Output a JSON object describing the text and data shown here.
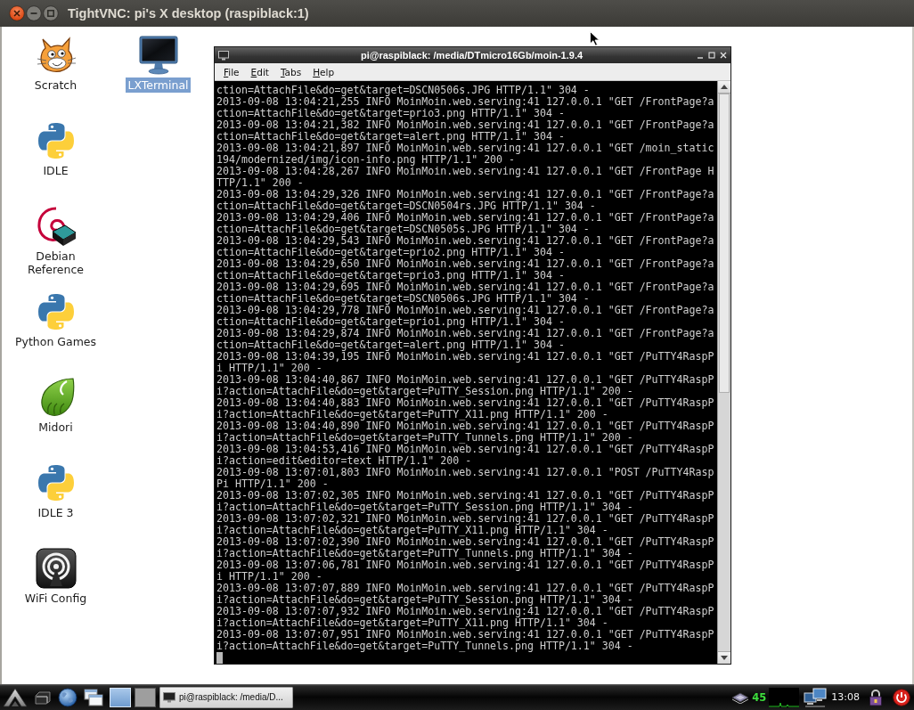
{
  "window": {
    "title": "TightVNC: pi's X desktop (raspiblack:1)"
  },
  "desktop_icons": [
    {
      "label": "Scratch",
      "kind": "scratch",
      "selected": false
    },
    {
      "label": "IDLE",
      "kind": "python",
      "selected": false
    },
    {
      "label": "Debian Reference",
      "kind": "debian",
      "selected": false
    },
    {
      "label": "Python Games",
      "kind": "python",
      "selected": false
    },
    {
      "label": "Midori",
      "kind": "midori",
      "selected": false
    },
    {
      "label": "IDLE 3",
      "kind": "python",
      "selected": false
    },
    {
      "label": "WiFi Config",
      "kind": "wifi",
      "selected": false
    },
    {
      "label": "LXTerminal",
      "kind": "terminal",
      "selected": true
    }
  ],
  "terminal": {
    "title": "pi@raspiblack: /media/DTmicro16Gb/moin-1.9.4",
    "menu": [
      "File",
      "Edit",
      "Tabs",
      "Help"
    ],
    "lines": [
      "ction=AttachFile&do=get&target=DSCN0506s.JPG HTTP/1.1\" 304 -",
      "2013-09-08 13:04:21,255 INFO MoinMoin.web.serving:41 127.0.0.1 \"GET /FrontPage?a",
      "ction=AttachFile&do=get&target=prio3.png HTTP/1.1\" 304 -",
      "2013-09-08 13:04:21,382 INFO MoinMoin.web.serving:41 127.0.0.1 \"GET /FrontPage?a",
      "ction=AttachFile&do=get&target=alert.png HTTP/1.1\" 304 -",
      "2013-09-08 13:04:21,897 INFO MoinMoin.web.serving:41 127.0.0.1 \"GET /moin_static",
      "194/modernized/img/icon-info.png HTTP/1.1\" 200 -",
      "2013-09-08 13:04:28,267 INFO MoinMoin.web.serving:41 127.0.0.1 \"GET /FrontPage H",
      "TTP/1.1\" 200 -",
      "2013-09-08 13:04:29,326 INFO MoinMoin.web.serving:41 127.0.0.1 \"GET /FrontPage?a",
      "ction=AttachFile&do=get&target=DSCN0504rs.JPG HTTP/1.1\" 304 -",
      "2013-09-08 13:04:29,406 INFO MoinMoin.web.serving:41 127.0.0.1 \"GET /FrontPage?a",
      "ction=AttachFile&do=get&target=DSCN0505s.JPG HTTP/1.1\" 304 -",
      "2013-09-08 13:04:29,543 INFO MoinMoin.web.serving:41 127.0.0.1 \"GET /FrontPage?a",
      "ction=AttachFile&do=get&target=prio2.png HTTP/1.1\" 304 -",
      "2013-09-08 13:04:29,650 INFO MoinMoin.web.serving:41 127.0.0.1 \"GET /FrontPage?a",
      "ction=AttachFile&do=get&target=prio3.png HTTP/1.1\" 304 -",
      "2013-09-08 13:04:29,695 INFO MoinMoin.web.serving:41 127.0.0.1 \"GET /FrontPage?a",
      "ction=AttachFile&do=get&target=DSCN0506s.JPG HTTP/1.1\" 304 -",
      "2013-09-08 13:04:29,778 INFO MoinMoin.web.serving:41 127.0.0.1 \"GET /FrontPage?a",
      "ction=AttachFile&do=get&target=prio1.png HTTP/1.1\" 304 -",
      "2013-09-08 13:04:29,874 INFO MoinMoin.web.serving:41 127.0.0.1 \"GET /FrontPage?a",
      "ction=AttachFile&do=get&target=alert.png HTTP/1.1\" 304 -",
      "2013-09-08 13:04:39,195 INFO MoinMoin.web.serving:41 127.0.0.1 \"GET /PuTTY4RaspP",
      "i HTTP/1.1\" 200 -",
      "2013-09-08 13:04:40,867 INFO MoinMoin.web.serving:41 127.0.0.1 \"GET /PuTTY4RaspP",
      "i?action=AttachFile&do=get&target=PuTTY_Session.png HTTP/1.1\" 200 -",
      "2013-09-08 13:04:40,883 INFO MoinMoin.web.serving:41 127.0.0.1 \"GET /PuTTY4RaspP",
      "i?action=AttachFile&do=get&target=PuTTY_X11.png HTTP/1.1\" 200 -",
      "2013-09-08 13:04:40,890 INFO MoinMoin.web.serving:41 127.0.0.1 \"GET /PuTTY4RaspP",
      "i?action=AttachFile&do=get&target=PuTTY_Tunnels.png HTTP/1.1\" 200 -",
      "2013-09-08 13:04:53,416 INFO MoinMoin.web.serving:41 127.0.0.1 \"GET /PuTTY4RaspP",
      "i?action=edit&editor=text HTTP/1.1\" 200 -",
      "2013-09-08 13:07:01,803 INFO MoinMoin.web.serving:41 127.0.0.1 \"POST /PuTTY4Rasp",
      "Pi HTTP/1.1\" 200 -",
      "2013-09-08 13:07:02,305 INFO MoinMoin.web.serving:41 127.0.0.1 \"GET /PuTTY4RaspP",
      "i?action=AttachFile&do=get&target=PuTTY_Session.png HTTP/1.1\" 304 -",
      "2013-09-08 13:07:02,321 INFO MoinMoin.web.serving:41 127.0.0.1 \"GET /PuTTY4RaspP",
      "i?action=AttachFile&do=get&target=PuTTY_X11.png HTTP/1.1\" 304 -",
      "2013-09-08 13:07:02,390 INFO MoinMoin.web.serving:41 127.0.0.1 \"GET /PuTTY4RaspP",
      "i?action=AttachFile&do=get&target=PuTTY_Tunnels.png HTTP/1.1\" 304 -",
      "2013-09-08 13:07:06,781 INFO MoinMoin.web.serving:41 127.0.0.1 \"GET /PuTTY4RaspP",
      "i HTTP/1.1\" 200 -",
      "2013-09-08 13:07:07,889 INFO MoinMoin.web.serving:41 127.0.0.1 \"GET /PuTTY4RaspP",
      "i?action=AttachFile&do=get&target=PuTTY_Session.png HTTP/1.1\" 304 -",
      "2013-09-08 13:07:07,932 INFO MoinMoin.web.serving:41 127.0.0.1 \"GET /PuTTY4RaspP",
      "i?action=AttachFile&do=get&target=PuTTY_X11.png HTTP/1.1\" 304 -",
      "2013-09-08 13:07:07,951 INFO MoinMoin.web.serving:41 127.0.0.1 \"GET /PuTTY4RaspP",
      "i?action=AttachFile&do=get&target=PuTTY_Tunnels.png HTTP/1.1\" 304 -"
    ]
  },
  "taskbar": {
    "workspaces": [
      {
        "selected": true
      },
      {
        "selected": false
      }
    ],
    "tasks": [
      {
        "label": "pi@raspiblack: /media/D..."
      }
    ],
    "temperature": "45",
    "clock": "13:08"
  }
}
